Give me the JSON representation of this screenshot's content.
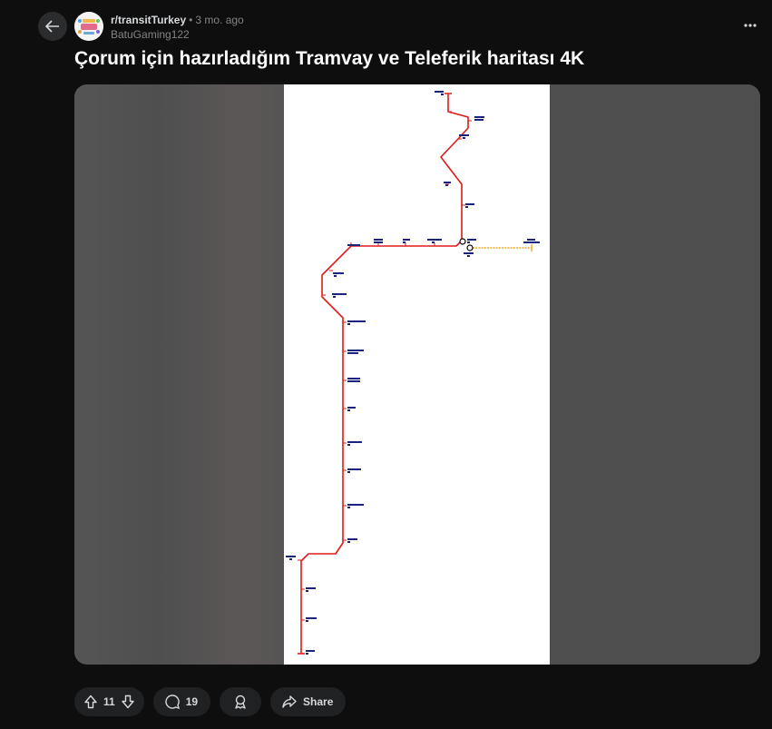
{
  "post": {
    "subreddit": "r/transitTurkey",
    "separator": "•",
    "time": "3 mo. ago",
    "author": "BatuGaming122",
    "title": "Çorum için hazırladığım Tramvay ve Teleferik haritası 4K"
  },
  "actions": {
    "upvotes": "11",
    "comments": "19",
    "share_label": "Share"
  },
  "colors": {
    "tram_line": "#e01a1a",
    "cable_car_line": "#f5a623",
    "background": "#0e0e0f"
  },
  "icons": [
    "back-arrow-icon",
    "more-icon",
    "upvote-icon",
    "downvote-icon",
    "comment-icon",
    "award-icon",
    "share-icon"
  ]
}
